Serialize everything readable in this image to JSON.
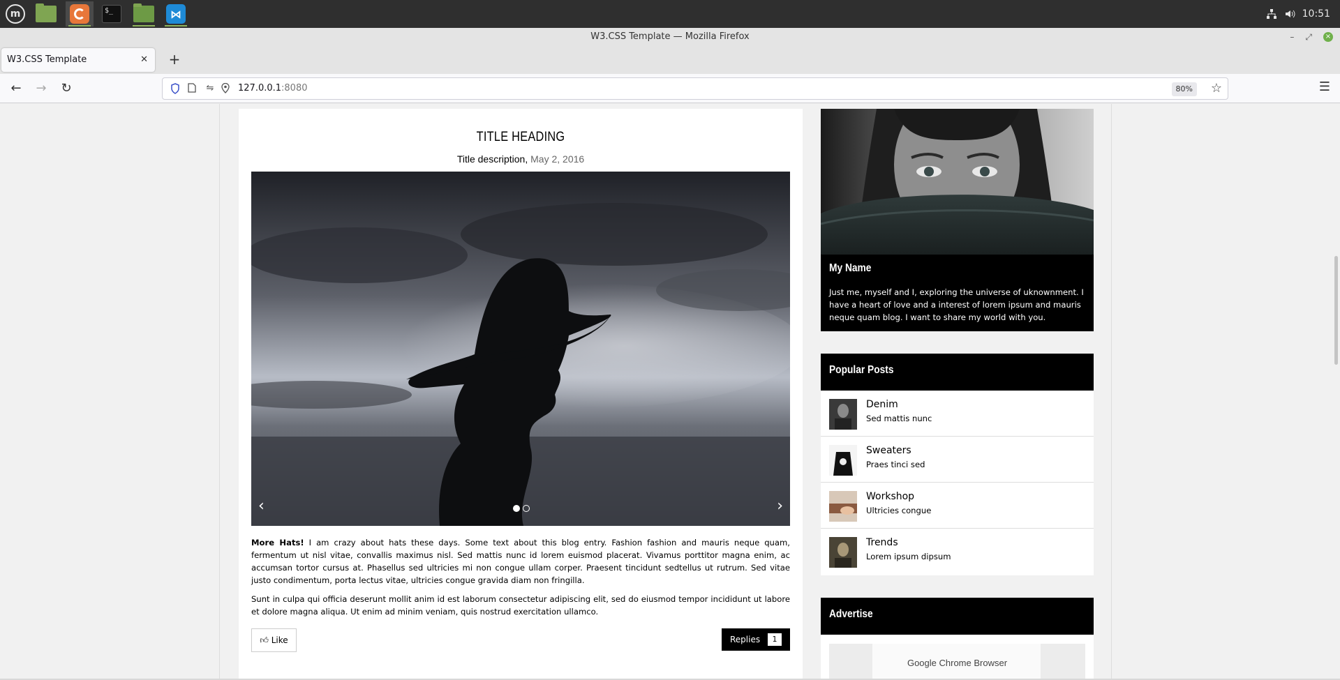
{
  "taskbar": {
    "apps": [
      {
        "name": "Linux Mint menu",
        "icon": "mint-menu-icon"
      },
      {
        "name": "Files",
        "icon": "folder-icon"
      },
      {
        "name": "Firefox",
        "icon": "firefox-icon"
      },
      {
        "name": "Terminal",
        "icon": "terminal-icon",
        "glyph": "$_"
      },
      {
        "name": "Files",
        "icon": "folder-icon"
      },
      {
        "name": "Visual Studio Code",
        "icon": "vscode-icon"
      }
    ],
    "clock": "10:51",
    "tray_icons": [
      "network-icon",
      "volume-icon"
    ]
  },
  "window": {
    "title": "W3.CSS Template — Mozilla Firefox"
  },
  "browser": {
    "tab_title": "W3.CSS Template",
    "url_host": "127.0.0.1",
    "url_port": ":8080",
    "zoom": "80%"
  },
  "blog": {
    "title": "TITLE HEADING",
    "subtitle": "Title description,",
    "date": "May 2, 2016",
    "slider": {
      "slide_count": 2,
      "active_slide": 1,
      "prev": "‹",
      "next": "›"
    },
    "paragraph1_bold": "More Hats!",
    "paragraph1": " I am crazy about hats these days. Some text about this blog entry. Fashion fashion and mauris neque quam, fermentum ut nisl vitae, convallis maximus nisl. Sed mattis nunc id lorem euismod placerat. Vivamus porttitor magna enim, ac accumsan tortor cursus at. Phasellus sed ultricies mi non congue ullam corper. Praesent tincidunt sedtellus ut rutrum. Sed vitae justo condimentum, porta lectus vitae, ultricies congue gravida diam non fringilla.",
    "paragraph2": "Sunt in culpa qui officia deserunt mollit anim id est laborum consectetur adipiscing elit, sed do eiusmod tempor incididunt ut labore et dolore magna aliqua. Ut enim ad minim veniam, quis nostrud exercitation ullamco.",
    "like_label": "Like",
    "replies_label": "Replies",
    "replies_count": "1"
  },
  "sidebar": {
    "profile": {
      "name": "My Name",
      "bio": "Just me, myself and I, exploring the universe of uknownment. I have a heart of love and a interest of lorem ipsum and mauris neque quam blog. I want to share my world with you."
    },
    "popular": {
      "heading": "Popular Posts",
      "posts": [
        {
          "title": "Denim",
          "sub": "Sed mattis nunc"
        },
        {
          "title": "Sweaters",
          "sub": "Praes tinci sed"
        },
        {
          "title": "Workshop",
          "sub": "Ultricies congue"
        },
        {
          "title": "Trends",
          "sub": "Lorem ipsum dipsum"
        }
      ]
    },
    "advertise": {
      "heading": "Advertise",
      "ad_text": "Google Chrome Browser"
    }
  },
  "colors": {
    "accent_black": "#000000",
    "taskbar_bg": "#2f2f2f",
    "mint_green": "#8fb45c"
  }
}
